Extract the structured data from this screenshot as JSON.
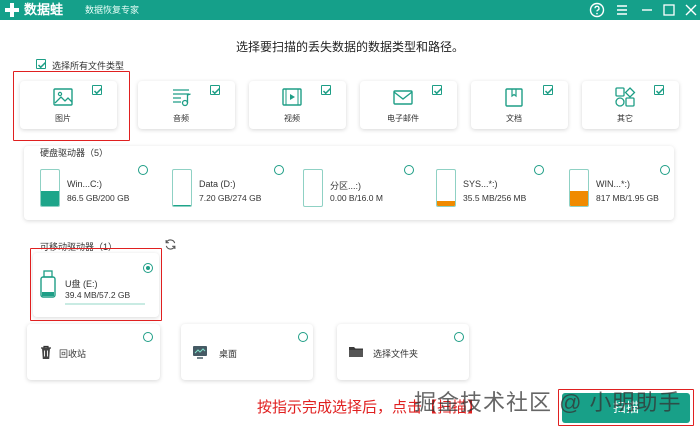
{
  "app": {
    "name": "数据蛙",
    "subtitle": "数据恢复专家"
  },
  "colors": {
    "accent": "#15a08a",
    "highlight": "#e02020"
  },
  "header": {
    "instruction": "选择要扫描的丢失数据的数据类型和路径。"
  },
  "file_types": {
    "select_all_label": "选择所有文件类型",
    "items": [
      {
        "label": "图片",
        "icon": "image-icon",
        "checked": true
      },
      {
        "label": "音频",
        "icon": "music-icon",
        "checked": true
      },
      {
        "label": "视频",
        "icon": "video-icon",
        "checked": true
      },
      {
        "label": "电子邮件",
        "icon": "email-icon",
        "checked": true
      },
      {
        "label": "文档",
        "icon": "document-icon",
        "checked": true
      },
      {
        "label": "其它",
        "icon": "other-icon",
        "checked": true
      }
    ]
  },
  "hard_drives": {
    "title": "硬盘驱动器（5）",
    "items": [
      {
        "name": "Win...C:)",
        "size": "86.5 GB/200 GB",
        "fill_fraction": 0.43,
        "fill_color": "#1ea58a"
      },
      {
        "name": "Data (D:)",
        "size": "7.20 GB/274 GB",
        "fill_fraction": 0.03,
        "fill_color": "#1ea58a"
      },
      {
        "name": "分区...:)",
        "size": "0.00  B/16.0 M",
        "fill_fraction": 0.0,
        "fill_color": "#1ea58a"
      },
      {
        "name": "SYS...*:)",
        "size": "35.5 MB/256 MB",
        "fill_fraction": 0.14,
        "fill_color": "#f08a00"
      },
      {
        "name": "WIN...*:)",
        "size": "817 MB/1.95 GB",
        "fill_fraction": 0.42,
        "fill_color": "#f08a00"
      }
    ]
  },
  "removable": {
    "title": "可移动驱动器（1）",
    "drive": {
      "name": "U盘 (E:)",
      "size": "39.4 MB/57.2 GB",
      "selected": true,
      "fill_fraction": 0.01
    }
  },
  "locations": [
    {
      "label": "回收站",
      "icon": "recycle-bin-icon"
    },
    {
      "label": "桌面",
      "icon": "desktop-icon"
    },
    {
      "label": "选择文件夹",
      "icon": "folder-icon"
    }
  ],
  "footer": {
    "annotation": "按指示完成选择后，点击【扫描】",
    "watermark": "掘金技术社区 @ 小明助手",
    "scan_label": "扫描"
  }
}
